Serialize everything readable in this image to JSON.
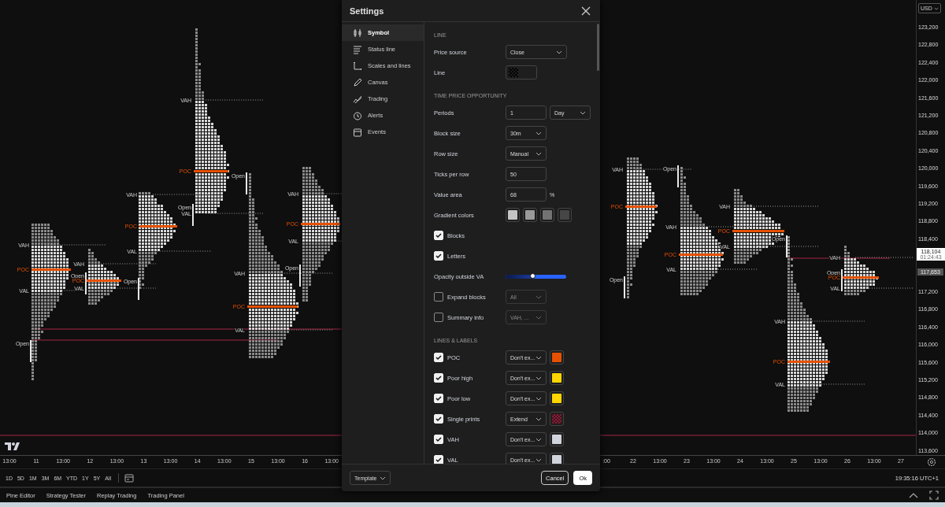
{
  "profiles": [
    {
      "labels": [
        {
          "kind": "vah",
          "text": "VAH"
        },
        {
          "kind": "poc",
          "text": "POC"
        },
        {
          "kind": "val",
          "text": "VAL"
        },
        {
          "kind": "open",
          "text": "Open"
        }
      ]
    },
    {
      "labels": [
        {
          "kind": "vah",
          "text": "VAH"
        },
        {
          "kind": "open",
          "text": "Open"
        },
        {
          "kind": "poc",
          "text": "POC"
        },
        {
          "kind": "val",
          "text": "VAL"
        }
      ]
    },
    {
      "labels": [
        {
          "kind": "vah",
          "text": "VAH"
        },
        {
          "kind": "poc",
          "text": "POC"
        },
        {
          "kind": "val",
          "text": "VAL"
        },
        {
          "kind": "open",
          "text": "Open"
        }
      ]
    },
    {
      "labels": [
        {
          "kind": "vah",
          "text": "VAH"
        },
        {
          "kind": "poc",
          "text": "POC"
        },
        {
          "kind": "open",
          "text": "Open"
        },
        {
          "kind": "val",
          "text": "VAL"
        }
      ]
    },
    {
      "labels": [
        {
          "kind": "open",
          "text": "Open"
        },
        {
          "kind": "vah",
          "text": "VAH"
        },
        {
          "kind": "poc",
          "text": "POC"
        },
        {
          "kind": "val",
          "text": "VAL"
        }
      ]
    },
    {
      "labels": [
        {
          "kind": "vah",
          "text": "VAH"
        },
        {
          "kind": "poc",
          "text": "POC"
        },
        {
          "kind": "val",
          "text": "VAL"
        },
        {
          "kind": "open",
          "text": "Open"
        }
      ]
    },
    {
      "labels": [
        {
          "kind": "vah",
          "text": "VAH"
        },
        {
          "kind": "poc",
          "text": "POC"
        },
        {
          "kind": "open",
          "text": "Open"
        }
      ]
    },
    {
      "labels": [
        {
          "kind": "open",
          "text": "Open"
        },
        {
          "kind": "vah",
          "text": "VAH"
        },
        {
          "kind": "poc",
          "text": "POC"
        },
        {
          "kind": "val",
          "text": "VAL"
        }
      ]
    },
    {
      "labels": [
        {
          "kind": "vah",
          "text": "VAH"
        },
        {
          "kind": "poc",
          "text": "POC"
        },
        {
          "kind": "val",
          "text": "VAL"
        }
      ]
    },
    {
      "labels": [
        {
          "kind": "open",
          "text": "Open"
        },
        {
          "kind": "vah",
          "text": "VAH"
        },
        {
          "kind": "poc",
          "text": "POC"
        },
        {
          "kind": "val",
          "text": "VAL"
        }
      ]
    },
    {
      "labels": [
        {
          "kind": "vah",
          "text": "VAH"
        },
        {
          "kind": "open",
          "text": "Open"
        },
        {
          "kind": "poc",
          "text": "POC"
        },
        {
          "kind": "val",
          "text": "VAL"
        }
      ]
    }
  ],
  "price_axis": {
    "currency": "USD",
    "ticks": [
      "123,200",
      "122,800",
      "122,400",
      "122,000",
      "121,600",
      "121,200",
      "120,800",
      "120,400",
      "120,000",
      "119,600",
      "119,200",
      "118,800",
      "118,400",
      "117,200",
      "116,800",
      "116,400",
      "116,000",
      "115,600",
      "115,200",
      "114,800",
      "114,400",
      "114,000",
      "113,600"
    ],
    "last_price": {
      "price": "118,104",
      "countdown": "01:24:43"
    },
    "marker_price": "117,653"
  },
  "time_axis": {
    "left_labels": [
      "13:00",
      "11",
      "13:00",
      "12",
      "13:00",
      "13",
      "13:00",
      "14",
      "13:00",
      "15",
      "13:00",
      "16",
      "13:00"
    ],
    "right_labels": [
      ":00",
      "22",
      "13:00",
      "23",
      "13:00",
      "24",
      "13:00",
      "25",
      "13:00",
      "26",
      "13:00",
      "27"
    ]
  },
  "ranges": [
    "1D",
    "5D",
    "1M",
    "3M",
    "6M",
    "YTD",
    "1Y",
    "5Y",
    "All"
  ],
  "clock": "19:35:16 UTC+1",
  "bottom_tabs": [
    "Pine Editor",
    "Strategy Tester",
    "Replay Trading",
    "Trading Panel"
  ],
  "dialog": {
    "title": "Settings",
    "sidebar": [
      {
        "label": "Symbol",
        "selected": true
      },
      {
        "label": "Status line",
        "selected": false
      },
      {
        "label": "Scales and lines",
        "selected": false
      },
      {
        "label": "Canvas",
        "selected": false
      },
      {
        "label": "Trading",
        "selected": false
      },
      {
        "label": "Alerts",
        "selected": false
      },
      {
        "label": "Events",
        "selected": false
      }
    ],
    "rows": [
      {
        "kind": "header",
        "text": "LINE"
      },
      {
        "kind": "field",
        "label": "Price source",
        "controls": [
          {
            "kind": "wide-select",
            "value": "Close",
            "disabled": false
          }
        ]
      },
      {
        "kind": "field",
        "label": "Line",
        "controls": [
          {
            "kind": "checker",
            "color": "#000000"
          }
        ]
      },
      {
        "kind": "header",
        "text": "TIME PRICE OPPORTUNITY"
      },
      {
        "kind": "field",
        "label": "Periods",
        "controls": [
          {
            "kind": "input",
            "value": "1"
          },
          {
            "kind": "select",
            "value": "Day",
            "disabled": false
          }
        ]
      },
      {
        "kind": "field",
        "label": "Block size",
        "controls": [
          {
            "kind": "select",
            "value": "30m",
            "disabled": false
          }
        ]
      },
      {
        "kind": "field",
        "label": "Row size",
        "controls": [
          {
            "kind": "select",
            "value": "Manual",
            "disabled": false
          }
        ]
      },
      {
        "kind": "field",
        "label": "Ticks per row",
        "controls": [
          {
            "kind": "input",
            "value": "50"
          }
        ]
      },
      {
        "kind": "field",
        "label": "Value area",
        "controls": [
          {
            "kind": "input",
            "value": "68"
          },
          {
            "kind": "suffix",
            "text": "%"
          }
        ]
      },
      {
        "kind": "field",
        "label": "Gradient colors",
        "controls": [
          {
            "kind": "swatch",
            "color": "#c4c4c4"
          },
          {
            "kind": "swatch",
            "color": "#9a9a9a"
          },
          {
            "kind": "swatch",
            "color": "#737373"
          },
          {
            "kind": "swatch",
            "color": "#464646"
          }
        ]
      },
      {
        "kind": "checkbox",
        "label": "Blocks",
        "checked": true,
        "controls": []
      },
      {
        "kind": "checkbox",
        "label": "Letters",
        "checked": true,
        "controls": []
      },
      {
        "kind": "field",
        "label": "Opacity outside VA",
        "controls": [
          {
            "kind": "slider",
            "level": 0.45
          }
        ]
      },
      {
        "kind": "checkbox",
        "label": "Expand blocks",
        "checked": false,
        "controls": [
          {
            "kind": "select",
            "value": "All",
            "disabled": true
          }
        ]
      },
      {
        "kind": "checkbox",
        "label": "Summary info",
        "checked": false,
        "controls": [
          {
            "kind": "select",
            "value": "VAH, ...",
            "disabled": true
          }
        ]
      },
      {
        "kind": "header",
        "text": "LINES & LABELS"
      },
      {
        "kind": "checkbox",
        "label": "POC",
        "checked": true,
        "controls": [
          {
            "kind": "select",
            "value": "Don't ex...",
            "disabled": false
          },
          {
            "kind": "swatch",
            "color": "#e65100"
          }
        ]
      },
      {
        "kind": "checkbox",
        "label": "Poor high",
        "checked": true,
        "controls": [
          {
            "kind": "select",
            "value": "Don't ex...",
            "disabled": false
          },
          {
            "kind": "swatch",
            "color": "#ffd600"
          }
        ]
      },
      {
        "kind": "checkbox",
        "label": "Poor low",
        "checked": true,
        "controls": [
          {
            "kind": "select",
            "value": "Don't ex...",
            "disabled": false
          },
          {
            "kind": "swatch",
            "color": "#ffd600"
          }
        ]
      },
      {
        "kind": "checkbox",
        "label": "Single prints",
        "checked": true,
        "controls": [
          {
            "kind": "select",
            "value": "Extend",
            "disabled": false
          },
          {
            "kind": "checker",
            "color": "#5a0a1e"
          }
        ]
      },
      {
        "kind": "checkbox",
        "label": "VAH",
        "checked": true,
        "controls": [
          {
            "kind": "select",
            "value": "Don't ex...",
            "disabled": false
          },
          {
            "kind": "swatch",
            "color": "#d1d4dc"
          }
        ]
      },
      {
        "kind": "checkbox",
        "label": "VAL",
        "checked": true,
        "controls": [
          {
            "kind": "select",
            "value": "Don't ex...",
            "disabled": false
          },
          {
            "kind": "swatch",
            "color": "#d1d4dc"
          }
        ]
      }
    ],
    "template": "Template",
    "cancel": "Cancel",
    "ok": "Ok"
  }
}
